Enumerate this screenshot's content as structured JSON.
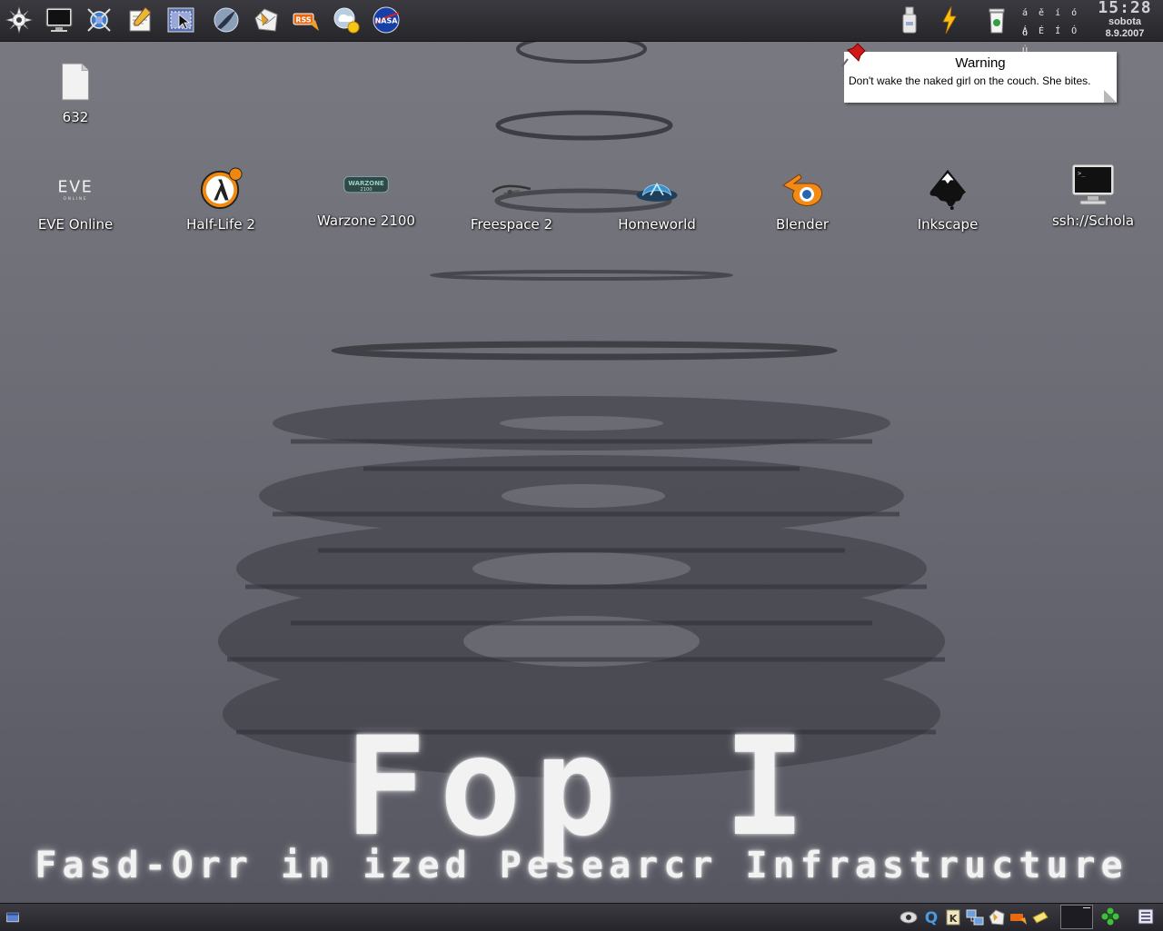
{
  "top_panel": {
    "launchers": [
      {
        "name": "kde-menu-icon"
      },
      {
        "name": "terminal-icon"
      },
      {
        "name": "network-globe-icon"
      },
      {
        "name": "text-editor-icon"
      },
      {
        "name": "screenshot-tool-icon"
      },
      {
        "name": "browser-icon"
      },
      {
        "name": "mail-client-icon"
      },
      {
        "name": "rss-reader-icon"
      },
      {
        "name": "weather-icon"
      },
      {
        "name": "nasa-icon",
        "text": "NASA"
      }
    ],
    "rss_label": "RSS",
    "tray": [
      {
        "name": "usb-device-icon"
      },
      {
        "name": "power-lightning-icon"
      },
      {
        "name": "trash-icon"
      }
    ],
    "keyboard_chars": [
      "á ě í ó ú",
      "Á É Í Ó Ú"
    ],
    "clock": {
      "time": "15:28",
      "day": "sobota",
      "date": "8.9.2007"
    }
  },
  "desktop": {
    "file_icon": {
      "label": "632"
    },
    "apps": [
      {
        "label": "EVE Online",
        "icon": "eve-online-logo-icon"
      },
      {
        "label": "Half-Life 2",
        "icon": "half-life-2-icon"
      },
      {
        "label": "Warzone 2100",
        "icon": "warzone-2100-icon"
      },
      {
        "label": "Freespace 2",
        "icon": "freespace-2-icon"
      },
      {
        "label": "Homeworld",
        "icon": "homeworld-icon"
      },
      {
        "label": "Blender",
        "icon": "blender-icon"
      },
      {
        "label": "Inkscape",
        "icon": "inkscape-icon"
      },
      {
        "label": "ssh://Schola",
        "icon": "terminal-monitor-icon"
      }
    ],
    "eve_logo_text": "EVE",
    "eve_logo_sub": "ONLINE",
    "warzone_logo_text": "WARZONE",
    "warzone_logo_sub": "2100"
  },
  "note": {
    "title": "Warning",
    "body": "Don't wake the naked girl on the couch. She bites."
  },
  "wallpaper": {
    "title": "Fop I",
    "subtitle": "Fasd-Orr in ized Pesearcr Infrastructure"
  },
  "bottom_panel": {
    "left_icon": "show-desktop-icon",
    "tray": [
      {
        "name": "eye-monitor-icon"
      },
      {
        "name": "q-app-icon",
        "text": "Q"
      },
      {
        "name": "k-app-icon",
        "text": "K"
      },
      {
        "name": "network-tray-icon"
      },
      {
        "name": "mail-tray-icon"
      },
      {
        "name": "rss-tray-icon"
      },
      {
        "name": "notes-tray-icon"
      }
    ],
    "pager_icon": "virtual-desktop-pager",
    "flower_icon": "green-flower-icon",
    "taskview_icon": "window-list-icon"
  },
  "colors": {
    "panel": "#2a2a30",
    "note_bg": "#ffffff",
    "accent_red": "#d01818"
  }
}
